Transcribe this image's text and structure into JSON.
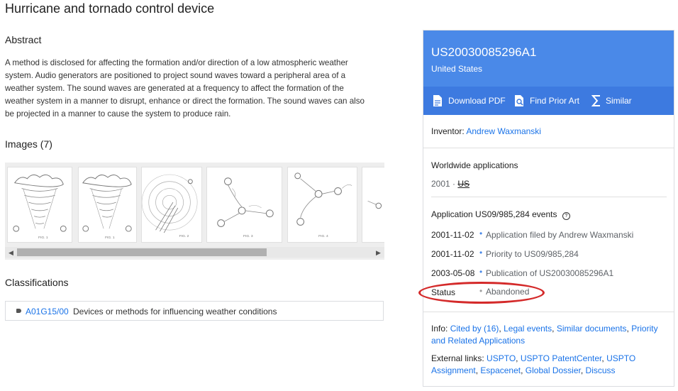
{
  "title": "Hurricane and tornado control device",
  "abstract": {
    "heading": "Abstract",
    "lines": [
      "A method is disclosed for affecting the formation and/or direction of a low atmospheric weather",
      "system. Audio generators are positioned to project sound waves toward a peripheral area of a",
      "weather system. The sound waves are generated at a frequency to affect the formation of the",
      "weather system in a manner to disrupt, enhance or direct the formation. The sound waves can also",
      "be projected in a manner to cause the system to produce rain."
    ]
  },
  "images": {
    "heading": "Images (7)",
    "thumbs": [
      {
        "caption": "FIG. 1"
      },
      {
        "caption": "FIG. 1"
      },
      {
        "caption": "FIG. 2"
      },
      {
        "caption": "FIG. 3"
      },
      {
        "caption": "FIG. 4"
      },
      {
        "caption": ""
      }
    ]
  },
  "classifications": {
    "heading": "Classifications",
    "code": "A01G15/00",
    "description": "Devices or methods for influencing weather conditions"
  },
  "panel": {
    "pub_number": "US20030085296A1",
    "country": "United States",
    "actions": {
      "download": "Download PDF",
      "prior_art": "Find Prior Art",
      "similar": "Similar"
    },
    "inventor_label": "Inventor:",
    "inventor": "Andrew Waxmanski",
    "worldwide_heading": "Worldwide applications",
    "worldwide_year": "2001",
    "worldwide_sep": "·",
    "worldwide_country": "US",
    "events_heading": "Application US09/985,284 events",
    "events": [
      {
        "date": "2001-11-02",
        "text": "Application filed by Andrew Waxmanski"
      },
      {
        "date": "2001-11-02",
        "text": "Priority to US09/985,284"
      },
      {
        "date": "2003-05-08",
        "text": "Publication of US20030085296A1"
      }
    ],
    "status_label": "Status",
    "status_value": "Abandoned",
    "info_label": "Info:",
    "info_links": [
      "Cited by (16)",
      "Legal events",
      "Similar documents",
      "Priority and Related Applications"
    ],
    "external_label": "External links:",
    "external_links": [
      "USPTO",
      "USPTO PatentCenter",
      "USPTO Assignment",
      "Espacenet",
      "Global Dossier",
      "Discuss"
    ]
  }
}
